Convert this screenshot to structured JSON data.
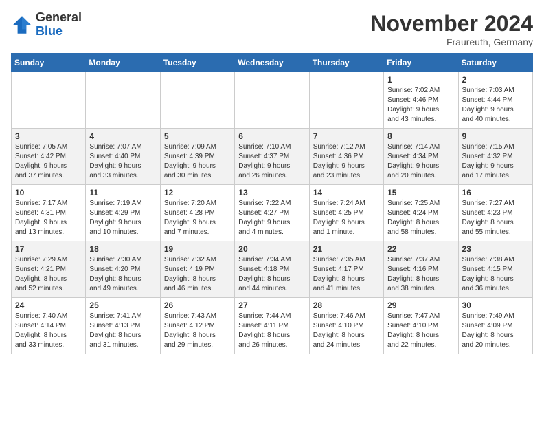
{
  "header": {
    "logo_general": "General",
    "logo_blue": "Blue",
    "month_title": "November 2024",
    "location": "Fraureuth, Germany"
  },
  "days_of_week": [
    "Sunday",
    "Monday",
    "Tuesday",
    "Wednesday",
    "Thursday",
    "Friday",
    "Saturday"
  ],
  "weeks": [
    [
      {
        "day": "",
        "info": ""
      },
      {
        "day": "",
        "info": ""
      },
      {
        "day": "",
        "info": ""
      },
      {
        "day": "",
        "info": ""
      },
      {
        "day": "",
        "info": ""
      },
      {
        "day": "1",
        "info": "Sunrise: 7:02 AM\nSunset: 4:46 PM\nDaylight: 9 hours\nand 43 minutes."
      },
      {
        "day": "2",
        "info": "Sunrise: 7:03 AM\nSunset: 4:44 PM\nDaylight: 9 hours\nand 40 minutes."
      }
    ],
    [
      {
        "day": "3",
        "info": "Sunrise: 7:05 AM\nSunset: 4:42 PM\nDaylight: 9 hours\nand 37 minutes."
      },
      {
        "day": "4",
        "info": "Sunrise: 7:07 AM\nSunset: 4:40 PM\nDaylight: 9 hours\nand 33 minutes."
      },
      {
        "day": "5",
        "info": "Sunrise: 7:09 AM\nSunset: 4:39 PM\nDaylight: 9 hours\nand 30 minutes."
      },
      {
        "day": "6",
        "info": "Sunrise: 7:10 AM\nSunset: 4:37 PM\nDaylight: 9 hours\nand 26 minutes."
      },
      {
        "day": "7",
        "info": "Sunrise: 7:12 AM\nSunset: 4:36 PM\nDaylight: 9 hours\nand 23 minutes."
      },
      {
        "day": "8",
        "info": "Sunrise: 7:14 AM\nSunset: 4:34 PM\nDaylight: 9 hours\nand 20 minutes."
      },
      {
        "day": "9",
        "info": "Sunrise: 7:15 AM\nSunset: 4:32 PM\nDaylight: 9 hours\nand 17 minutes."
      }
    ],
    [
      {
        "day": "10",
        "info": "Sunrise: 7:17 AM\nSunset: 4:31 PM\nDaylight: 9 hours\nand 13 minutes."
      },
      {
        "day": "11",
        "info": "Sunrise: 7:19 AM\nSunset: 4:29 PM\nDaylight: 9 hours\nand 10 minutes."
      },
      {
        "day": "12",
        "info": "Sunrise: 7:20 AM\nSunset: 4:28 PM\nDaylight: 9 hours\nand 7 minutes."
      },
      {
        "day": "13",
        "info": "Sunrise: 7:22 AM\nSunset: 4:27 PM\nDaylight: 9 hours\nand 4 minutes."
      },
      {
        "day": "14",
        "info": "Sunrise: 7:24 AM\nSunset: 4:25 PM\nDaylight: 9 hours\nand 1 minute."
      },
      {
        "day": "15",
        "info": "Sunrise: 7:25 AM\nSunset: 4:24 PM\nDaylight: 8 hours\nand 58 minutes."
      },
      {
        "day": "16",
        "info": "Sunrise: 7:27 AM\nSunset: 4:23 PM\nDaylight: 8 hours\nand 55 minutes."
      }
    ],
    [
      {
        "day": "17",
        "info": "Sunrise: 7:29 AM\nSunset: 4:21 PM\nDaylight: 8 hours\nand 52 minutes."
      },
      {
        "day": "18",
        "info": "Sunrise: 7:30 AM\nSunset: 4:20 PM\nDaylight: 8 hours\nand 49 minutes."
      },
      {
        "day": "19",
        "info": "Sunrise: 7:32 AM\nSunset: 4:19 PM\nDaylight: 8 hours\nand 46 minutes."
      },
      {
        "day": "20",
        "info": "Sunrise: 7:34 AM\nSunset: 4:18 PM\nDaylight: 8 hours\nand 44 minutes."
      },
      {
        "day": "21",
        "info": "Sunrise: 7:35 AM\nSunset: 4:17 PM\nDaylight: 8 hours\nand 41 minutes."
      },
      {
        "day": "22",
        "info": "Sunrise: 7:37 AM\nSunset: 4:16 PM\nDaylight: 8 hours\nand 38 minutes."
      },
      {
        "day": "23",
        "info": "Sunrise: 7:38 AM\nSunset: 4:15 PM\nDaylight: 8 hours\nand 36 minutes."
      }
    ],
    [
      {
        "day": "24",
        "info": "Sunrise: 7:40 AM\nSunset: 4:14 PM\nDaylight: 8 hours\nand 33 minutes."
      },
      {
        "day": "25",
        "info": "Sunrise: 7:41 AM\nSunset: 4:13 PM\nDaylight: 8 hours\nand 31 minutes."
      },
      {
        "day": "26",
        "info": "Sunrise: 7:43 AM\nSunset: 4:12 PM\nDaylight: 8 hours\nand 29 minutes."
      },
      {
        "day": "27",
        "info": "Sunrise: 7:44 AM\nSunset: 4:11 PM\nDaylight: 8 hours\nand 26 minutes."
      },
      {
        "day": "28",
        "info": "Sunrise: 7:46 AM\nSunset: 4:10 PM\nDaylight: 8 hours\nand 24 minutes."
      },
      {
        "day": "29",
        "info": "Sunrise: 7:47 AM\nSunset: 4:10 PM\nDaylight: 8 hours\nand 22 minutes."
      },
      {
        "day": "30",
        "info": "Sunrise: 7:49 AM\nSunset: 4:09 PM\nDaylight: 8 hours\nand 20 minutes."
      }
    ]
  ]
}
